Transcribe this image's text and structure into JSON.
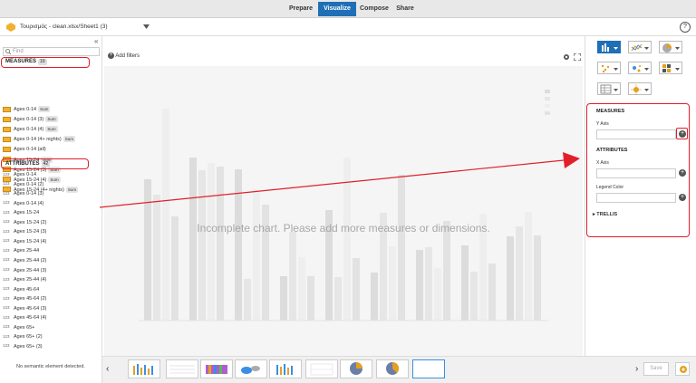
{
  "nav": {
    "tabs": [
      "Prepare",
      "Visualize",
      "Compose",
      "Share"
    ],
    "active": "Visualize"
  },
  "file": {
    "name": "Τουρισμός - clean.xlsx/Sheet1 (3)",
    "help": "?"
  },
  "left": {
    "search_placeholder": "Find",
    "measures_label": "MEASURES",
    "measures_count": "10",
    "sum_label": "Sum",
    "measures": [
      {
        "label": "Ages 0-14",
        "sum": true
      },
      {
        "label": "Ages 0-14 (3)",
        "sum": true
      },
      {
        "label": "Ages 0-14 (4)",
        "sum": true
      },
      {
        "label": "Ages 0-14 (4+ nights)",
        "sum": true
      },
      {
        "label": "Ages 0-14 (all)",
        "sum": false
      },
      {
        "label": "Ages 15-24",
        "sum": true
      },
      {
        "label": "Ages 15-24 (3)",
        "sum": true
      },
      {
        "label": "Ages 15-24 (4)",
        "sum": true
      },
      {
        "label": "Ages 15-24 (4+ nights)",
        "sum": true
      }
    ],
    "attributes_label": "ATTRIBUTES",
    "attributes_count": "42",
    "attr_icon": "123",
    "attributes": [
      "Ages 0-14",
      "Ages 0-14 (2)",
      "Ages 0-14 (3)",
      "Ages 0-14 (4)",
      "Ages 15-24",
      "Ages 15-24 (2)",
      "Ages 15-24 (3)",
      "Ages 15-24 (4)",
      "Ages 25-44",
      "Ages 25-44 (2)",
      "Ages 25-44 (3)",
      "Ages 25-44 (4)",
      "Ages 45-64",
      "Ages 45-64 (2)",
      "Ages 45-64 (3)",
      "Ages 45-64 (4)",
      "Ages 65+",
      "Ages 65+ (2)",
      "Ages 65+ (3)"
    ],
    "no_semantic": "No semantic element detected."
  },
  "center": {
    "add_filters": "Add filters",
    "incomplete_msg": "Incomplete chart. Please add more measures or dimensions."
  },
  "right": {
    "measures_hdr": "MEASURES",
    "y_axis": "Y Axis",
    "attributes_hdr": "ATTRIBUTES",
    "x_axis": "X Axis",
    "legend_color": "Legend Color",
    "trellis": "TRELLIS"
  },
  "bottom": {
    "save": "Save"
  },
  "colors": {
    "accent": "#1f6fb6",
    "annotation": "#e01f2b"
  }
}
